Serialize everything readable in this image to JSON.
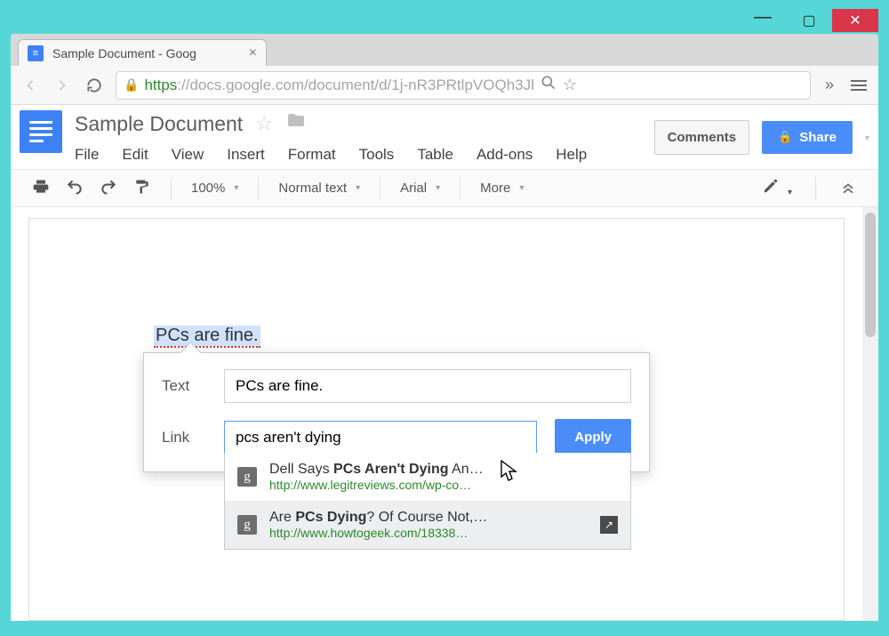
{
  "window": {
    "minimize_glyph": "—",
    "maximize_glyph": "▢",
    "close_glyph": "✕"
  },
  "tab": {
    "title": "Sample Document - Goog",
    "close_glyph": "×"
  },
  "nav": {
    "url_scheme": "https",
    "url_rest": "://docs.google.com/document/d/1j-nR3PRtlpVOQh3Jl",
    "chevrons": "»"
  },
  "docs": {
    "title": "Sample Document",
    "menus": [
      "File",
      "Edit",
      "View",
      "Insert",
      "Format",
      "Tools",
      "Table",
      "Add-ons",
      "Help"
    ],
    "comments_label": "Comments",
    "share_label": "Share"
  },
  "toolbar": {
    "zoom": "100%",
    "style": "Normal text",
    "font": "Arial",
    "more": "More"
  },
  "document": {
    "selected_text": "PCs are fine."
  },
  "link_dialog": {
    "text_label": "Text",
    "text_value": "PCs are fine.",
    "link_label": "Link",
    "link_value": "pcs aren't dying",
    "apply_label": "Apply",
    "suggestions": [
      {
        "title_pre": "Dell Says ",
        "title_bold": "PCs Aren't Dying",
        "title_post": " An…",
        "url": "http://www.legitreviews.com/wp-co…"
      },
      {
        "title_pre": "Are ",
        "title_bold": "PCs Dying",
        "title_post": "? Of Course Not,…",
        "url": "http://www.howtogeek.com/18338…"
      }
    ]
  }
}
